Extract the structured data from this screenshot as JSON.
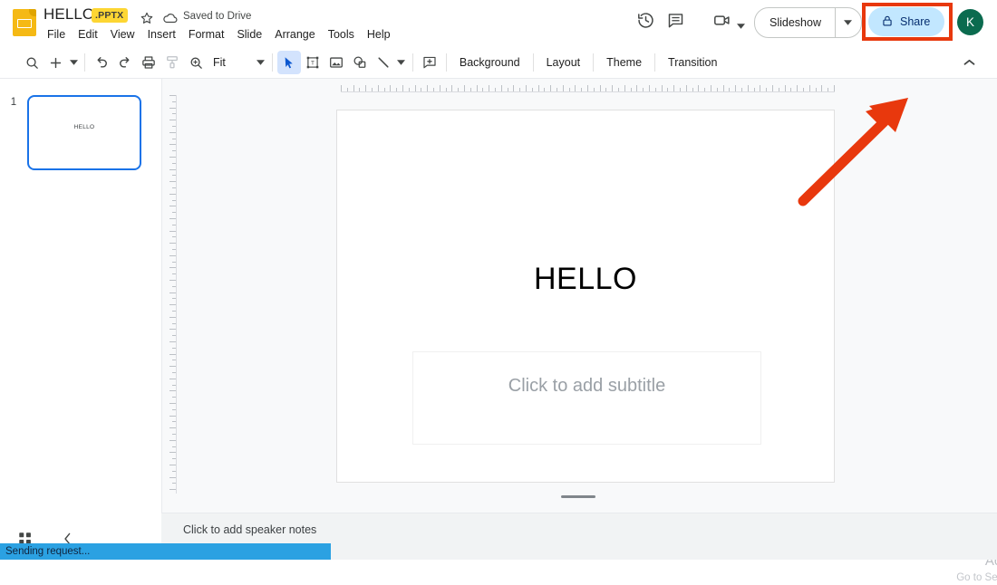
{
  "app": {
    "logo_icon": "google-slides-logo",
    "title": "HELLO",
    "format_badge": ".PPTX",
    "star_icon": "star-icon",
    "cloud_icon": "cloud-saved-icon",
    "save_status": "Saved to Drive"
  },
  "menubar": {
    "items": [
      {
        "label": "File"
      },
      {
        "label": "Edit"
      },
      {
        "label": "View"
      },
      {
        "label": "Insert"
      },
      {
        "label": "Format"
      },
      {
        "label": "Slide"
      },
      {
        "label": "Arrange"
      },
      {
        "label": "Tools"
      },
      {
        "label": "Help"
      }
    ]
  },
  "topright": {
    "history_icon": "version-history-icon",
    "comment_icon": "comment-icon",
    "meet_icon": "video-camera-icon",
    "meet_caret_icon": "chevron-down-icon",
    "slideshow_label": "Slideshow",
    "slideshow_caret_icon": "chevron-down-icon",
    "share_label": "Share",
    "share_icon": "lock-icon",
    "share_bg_color": "#c2e7ff",
    "share_text_color": "#062e6f",
    "avatar_initial": "K",
    "avatar_color": "#0b6b4f"
  },
  "toolbar": {
    "buttons": [
      {
        "name": "search-icon",
        "label": ""
      },
      {
        "name": "new-slide-icon",
        "label": ""
      },
      {
        "name": "undo-icon",
        "label": ""
      },
      {
        "name": "redo-icon",
        "label": ""
      },
      {
        "name": "print-icon",
        "label": ""
      },
      {
        "name": "paint-format-icon",
        "label": ""
      },
      {
        "name": "zoom-icon",
        "label": ""
      },
      {
        "name": "select-arrow-icon",
        "label": ""
      },
      {
        "name": "text-box-icon",
        "label": ""
      },
      {
        "name": "insert-image-icon",
        "label": ""
      },
      {
        "name": "shape-icon",
        "label": ""
      },
      {
        "name": "line-icon",
        "label": ""
      },
      {
        "name": "comment-add-icon",
        "label": ""
      }
    ],
    "zoom_value": "Fit",
    "background_label": "Background",
    "layout_label": "Layout",
    "theme_label": "Theme",
    "transition_label": "Transition",
    "collapse_icon": "chevron-up-icon"
  },
  "filmstrip": {
    "slides": [
      {
        "number": "1",
        "title": "HELLO",
        "selected": true
      }
    ]
  },
  "slide": {
    "title": "HELLO",
    "subtitle_placeholder": "Click to add subtitle"
  },
  "notes": {
    "placeholder": "Click to add speaker notes"
  },
  "bottom_left": {
    "grid_view_icon": "grid-view-icon",
    "collapse_filmstrip_icon": "chevron-left-icon"
  },
  "statusbar": {
    "message": "Sending request...",
    "color": "#2ba1e2"
  },
  "watermark": {
    "title": "Activate Windows",
    "subtitle": "Go to Settings to activate Windows."
  },
  "annotations": {
    "highlight_color": "#e8380d",
    "arrow_target": "share-button"
  }
}
